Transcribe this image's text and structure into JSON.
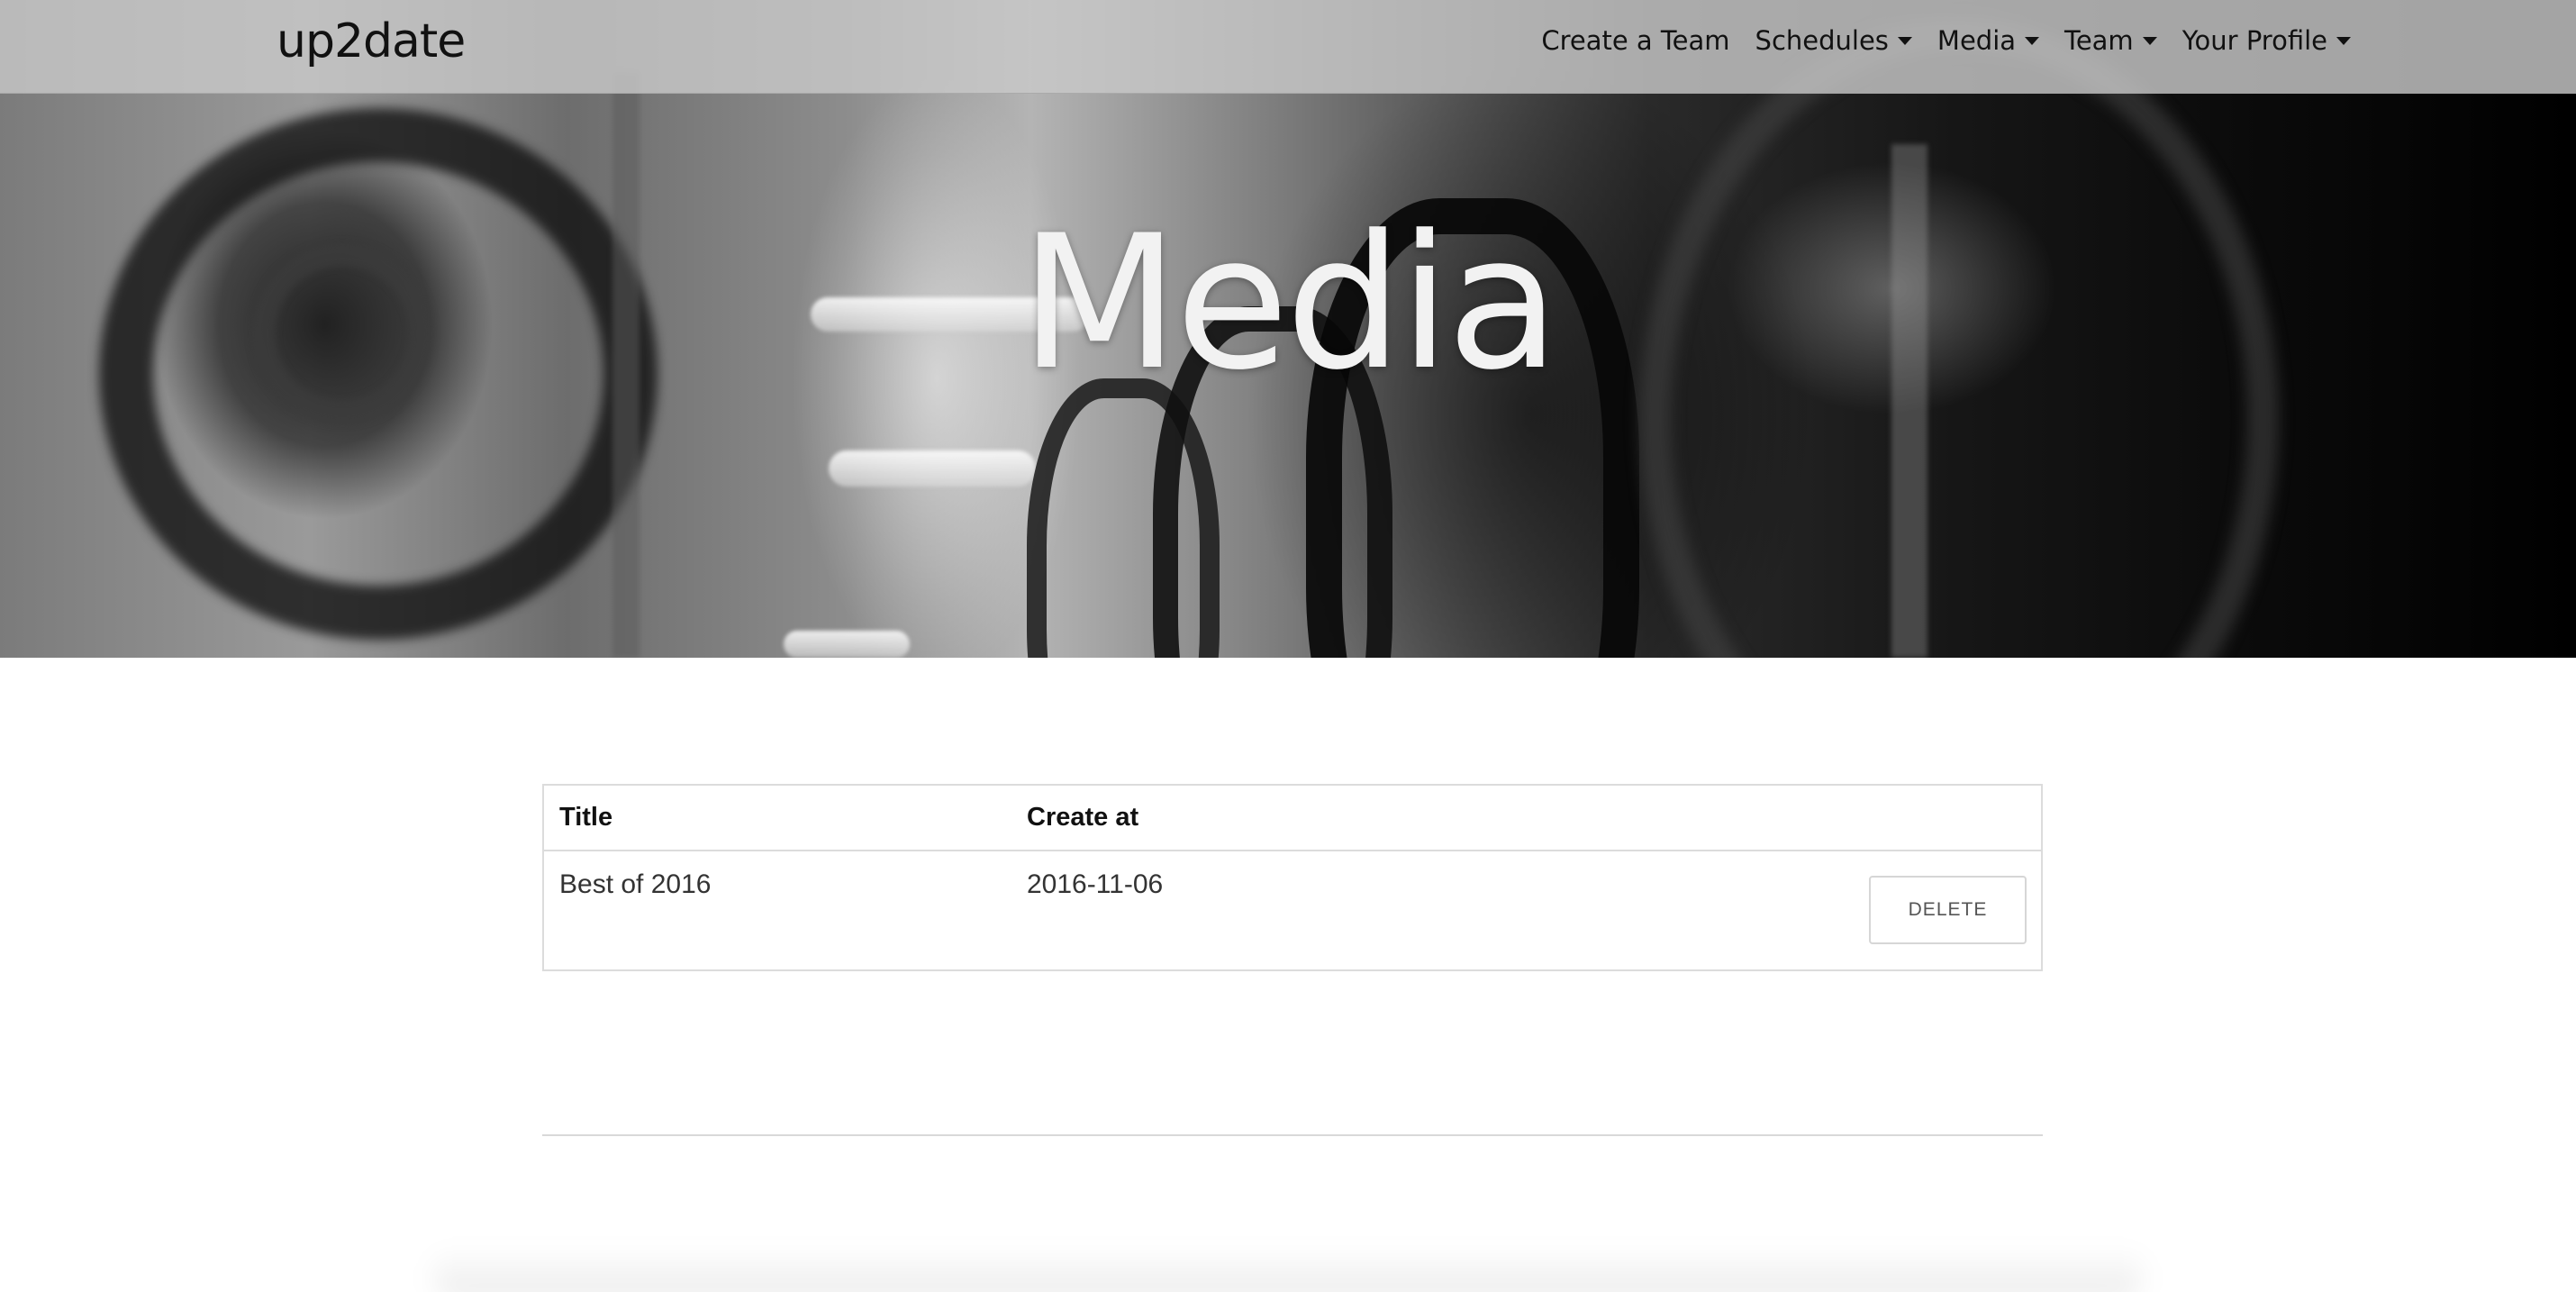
{
  "navbar": {
    "brand": "up2date",
    "items": [
      {
        "label": "Create a Team",
        "dropdown": false
      },
      {
        "label": "Schedules",
        "dropdown": true
      },
      {
        "label": "Media",
        "dropdown": true
      },
      {
        "label": "Team",
        "dropdown": true
      },
      {
        "label": "Your Profile",
        "dropdown": true
      }
    ]
  },
  "hero": {
    "title": "Media"
  },
  "media_table": {
    "headers": [
      "Title",
      "Create at"
    ],
    "rows": [
      {
        "title": "Best of 2016",
        "created_at": "2016-11-06",
        "action_label": "DELETE"
      }
    ]
  },
  "colors": {
    "navbar_bg": "#c8c8c8",
    "text": "#111111",
    "border": "#dcdcdc",
    "hero_title": "#f2f2f2"
  }
}
